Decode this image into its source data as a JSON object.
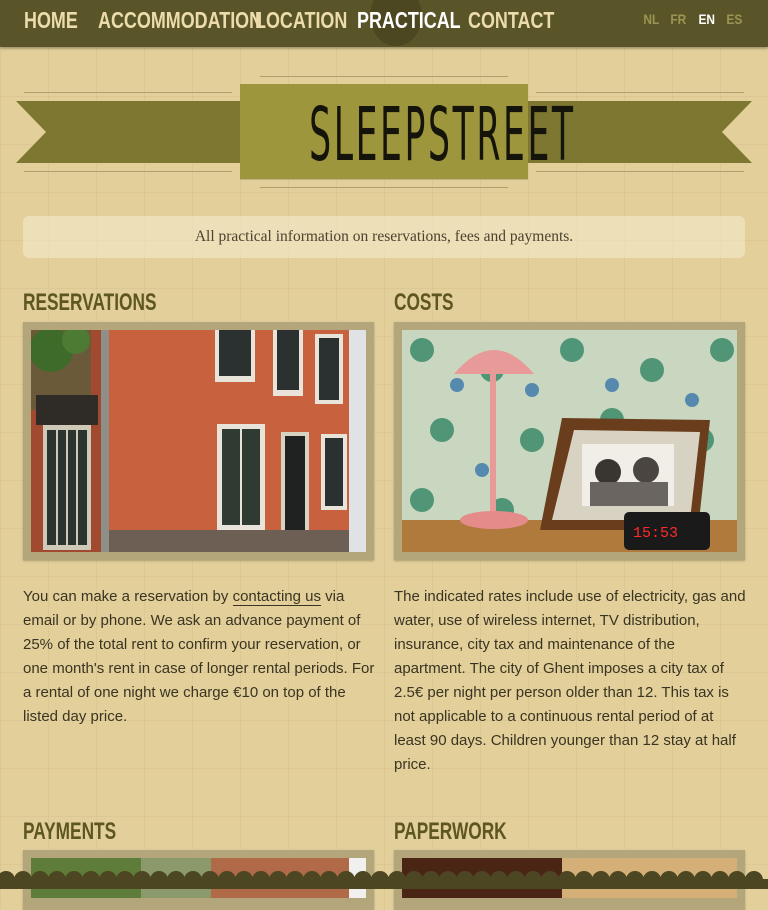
{
  "nav": {
    "items": [
      {
        "label": "HOME"
      },
      {
        "label": "ACCOMMODATION"
      },
      {
        "label": "LOCATION"
      },
      {
        "label": "PRACTICAL"
      },
      {
        "label": "CONTACT"
      }
    ],
    "active": "PRACTICAL",
    "languages": [
      "NL",
      "FR",
      "EN",
      "ES"
    ],
    "active_language": "EN"
  },
  "logo": {
    "text": "SLEEPSTREET"
  },
  "intro": "All practical information on reservations, fees and payments.",
  "sections": {
    "reservations": {
      "title": "RESERVATIONS",
      "text_before_link": "You can make a reservation by ",
      "link": "contacting us",
      "text_after_link": " via email or by phone. We ask an advance payment of 25% of the total rent to confirm your reservation, or one month's rent in case of longer rental periods. For a rental of one night we charge €10 on top of the listed day price."
    },
    "costs": {
      "title": "COSTS",
      "text": "The indicated rates include use of electricity, gas and water, use of wireless internet, TV distribution, insurance, city tax and maintenance of the apartment. The city of Ghent imposes a city tax of 2.5€ per night per person older than 12. This tax is not applicable to a continuous rental period of at least 90 days. Children younger than 12 stay at half price.",
      "clock": "15:53"
    },
    "payments": {
      "title": "PAYMENTS"
    },
    "paperwork": {
      "title": "PAPERWORK"
    }
  },
  "colors": {
    "background": "#e2cf9a",
    "nav_bar": "#5a5528",
    "ribbon": "#7d7732",
    "logo_box": "#9e963c",
    "heading": "#5e5621"
  }
}
